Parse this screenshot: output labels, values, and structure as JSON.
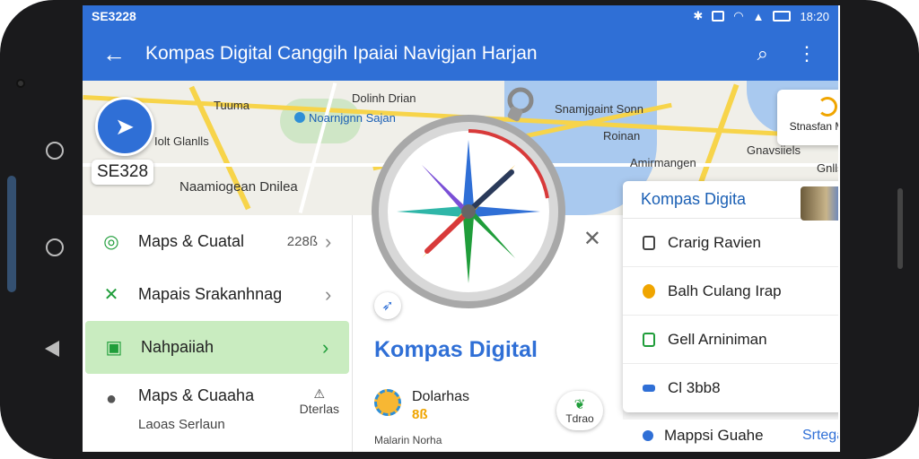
{
  "status": {
    "time": "SE3228",
    "clock": "18:20"
  },
  "app_bar": {
    "title": "Kompas Digital Canggih Ipaiai Navigjan Harjan"
  },
  "map": {
    "labels": [
      "Tuuma",
      "Dolinh Drian",
      "Iolt Glanlls",
      "Noarnjgnn Sajan",
      "Snamjgaint Sonn",
      "Roinan",
      "Naamiogean Dnilea",
      "Gnavsiiels",
      "Gnllshn",
      "Amirmangen"
    ],
    "location_label": "SE328",
    "float_card": "Stnasfan Margn"
  },
  "left_list": [
    {
      "label": "Maps & Cuatal",
      "meta": "228ß",
      "icon": "compass-badge-icon"
    },
    {
      "label": "Mapais Srakanhnag",
      "icon": "cross-tools-icon"
    },
    {
      "label": "Nahpaiiah",
      "icon": "book-icon",
      "active": true
    },
    {
      "label": "Maps & Cuaaha",
      "sub": "Laoas Serlaun",
      "right_sub": "Dterlas",
      "icon": "pin-icon"
    }
  ],
  "middle_card": {
    "heading": "Kompas Digital",
    "weather_main": "Dolarhas",
    "weather_val": "8ß",
    "pill_label": "Tdrao",
    "footer": "Malarin Norha"
  },
  "right_panel": {
    "title": "Kompas Digita",
    "items": [
      {
        "label": "Crarig Ravien",
        "color": "#444444"
      },
      {
        "label": "Balh Culang Irap",
        "color": "#f0a500"
      },
      {
        "label": "Gell Arniniman",
        "color": "#1f9d3a"
      },
      {
        "label": "Cl  3bb8",
        "color": "#2f6fd6"
      }
    ],
    "footer_label": "Mappsi Guahe",
    "footer_link": "Srtegan"
  }
}
